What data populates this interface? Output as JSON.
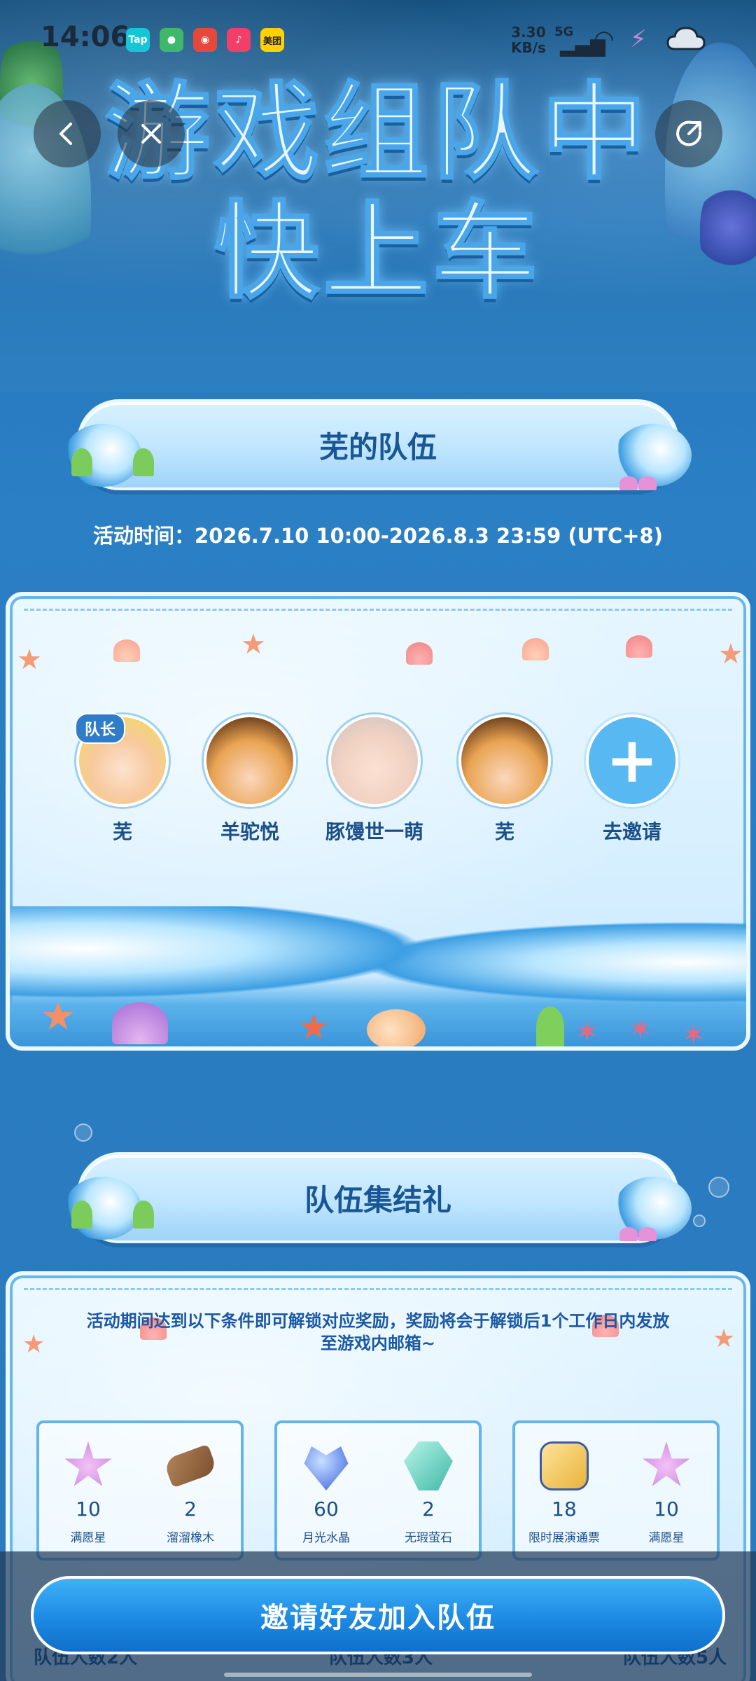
{
  "status_bar": {
    "time": "14:06",
    "net_speed": "3.30",
    "net_unit": "KB/s",
    "network_type": "5G",
    "apps": [
      {
        "name": "taptap-icon",
        "label": "Tap",
        "color": "#16c6d6"
      },
      {
        "name": "app-green-icon",
        "label": "",
        "color": "#3fb86b"
      },
      {
        "name": "weibo-icon",
        "label": "",
        "color": "#e6483b"
      },
      {
        "name": "douyin-icon",
        "label": "",
        "color": "#f23f68"
      },
      {
        "name": "meituan-icon",
        "label": "美团",
        "color": "#ffd100"
      }
    ]
  },
  "hero": {
    "title_line1": "游戏组队中",
    "title_line2": "快上车"
  },
  "team_section": {
    "title": "芜的队伍",
    "activity_time": "活动时间：2026.7.10 10:00-2026.8.3 23:59 (UTC+8)",
    "members": [
      {
        "name": "芜",
        "is_leader": true
      },
      {
        "name": "羊驼悦",
        "is_leader": false
      },
      {
        "name": "豚馒世一萌",
        "is_leader": false
      },
      {
        "name": "芜",
        "is_leader": false
      }
    ],
    "leader_tag": "队长",
    "invite_slot_label": "去邀请",
    "invite_plus": "+"
  },
  "gather_section": {
    "title": "队伍集结礼",
    "description": "活动期间达到以下条件即可解锁对应奖励，奖励将会于解锁后1个工作日内发放至游戏内邮箱~",
    "cards": [
      {
        "rewards": [
          {
            "name": "满愿星",
            "qty": "10",
            "icon": "star-icon",
            "color": "#d98ae6"
          },
          {
            "name": "溜溜橡木",
            "qty": "2",
            "icon": "wood-icon",
            "color": "#9a6a45"
          }
        ],
        "condition": "队伍人数2人"
      },
      {
        "rewards": [
          {
            "name": "月光水晶",
            "qty": "60",
            "icon": "heart-crystal-icon",
            "color": "#5b7fe8"
          },
          {
            "name": "无瑕萤石",
            "qty": "2",
            "icon": "gem-icon",
            "color": "#68d6c5"
          }
        ],
        "condition": "队伍人数3人"
      },
      {
        "rewards": [
          {
            "name": "限时展演通票",
            "qty": "18",
            "icon": "ticket-icon",
            "color": "#f0c24d"
          },
          {
            "name": "满愿星",
            "qty": "10",
            "icon": "star-icon",
            "color": "#d98ae6"
          }
        ],
        "condition": "队伍人数5人"
      }
    ]
  },
  "footer": {
    "invite_button": "邀请好友加入队伍"
  }
}
